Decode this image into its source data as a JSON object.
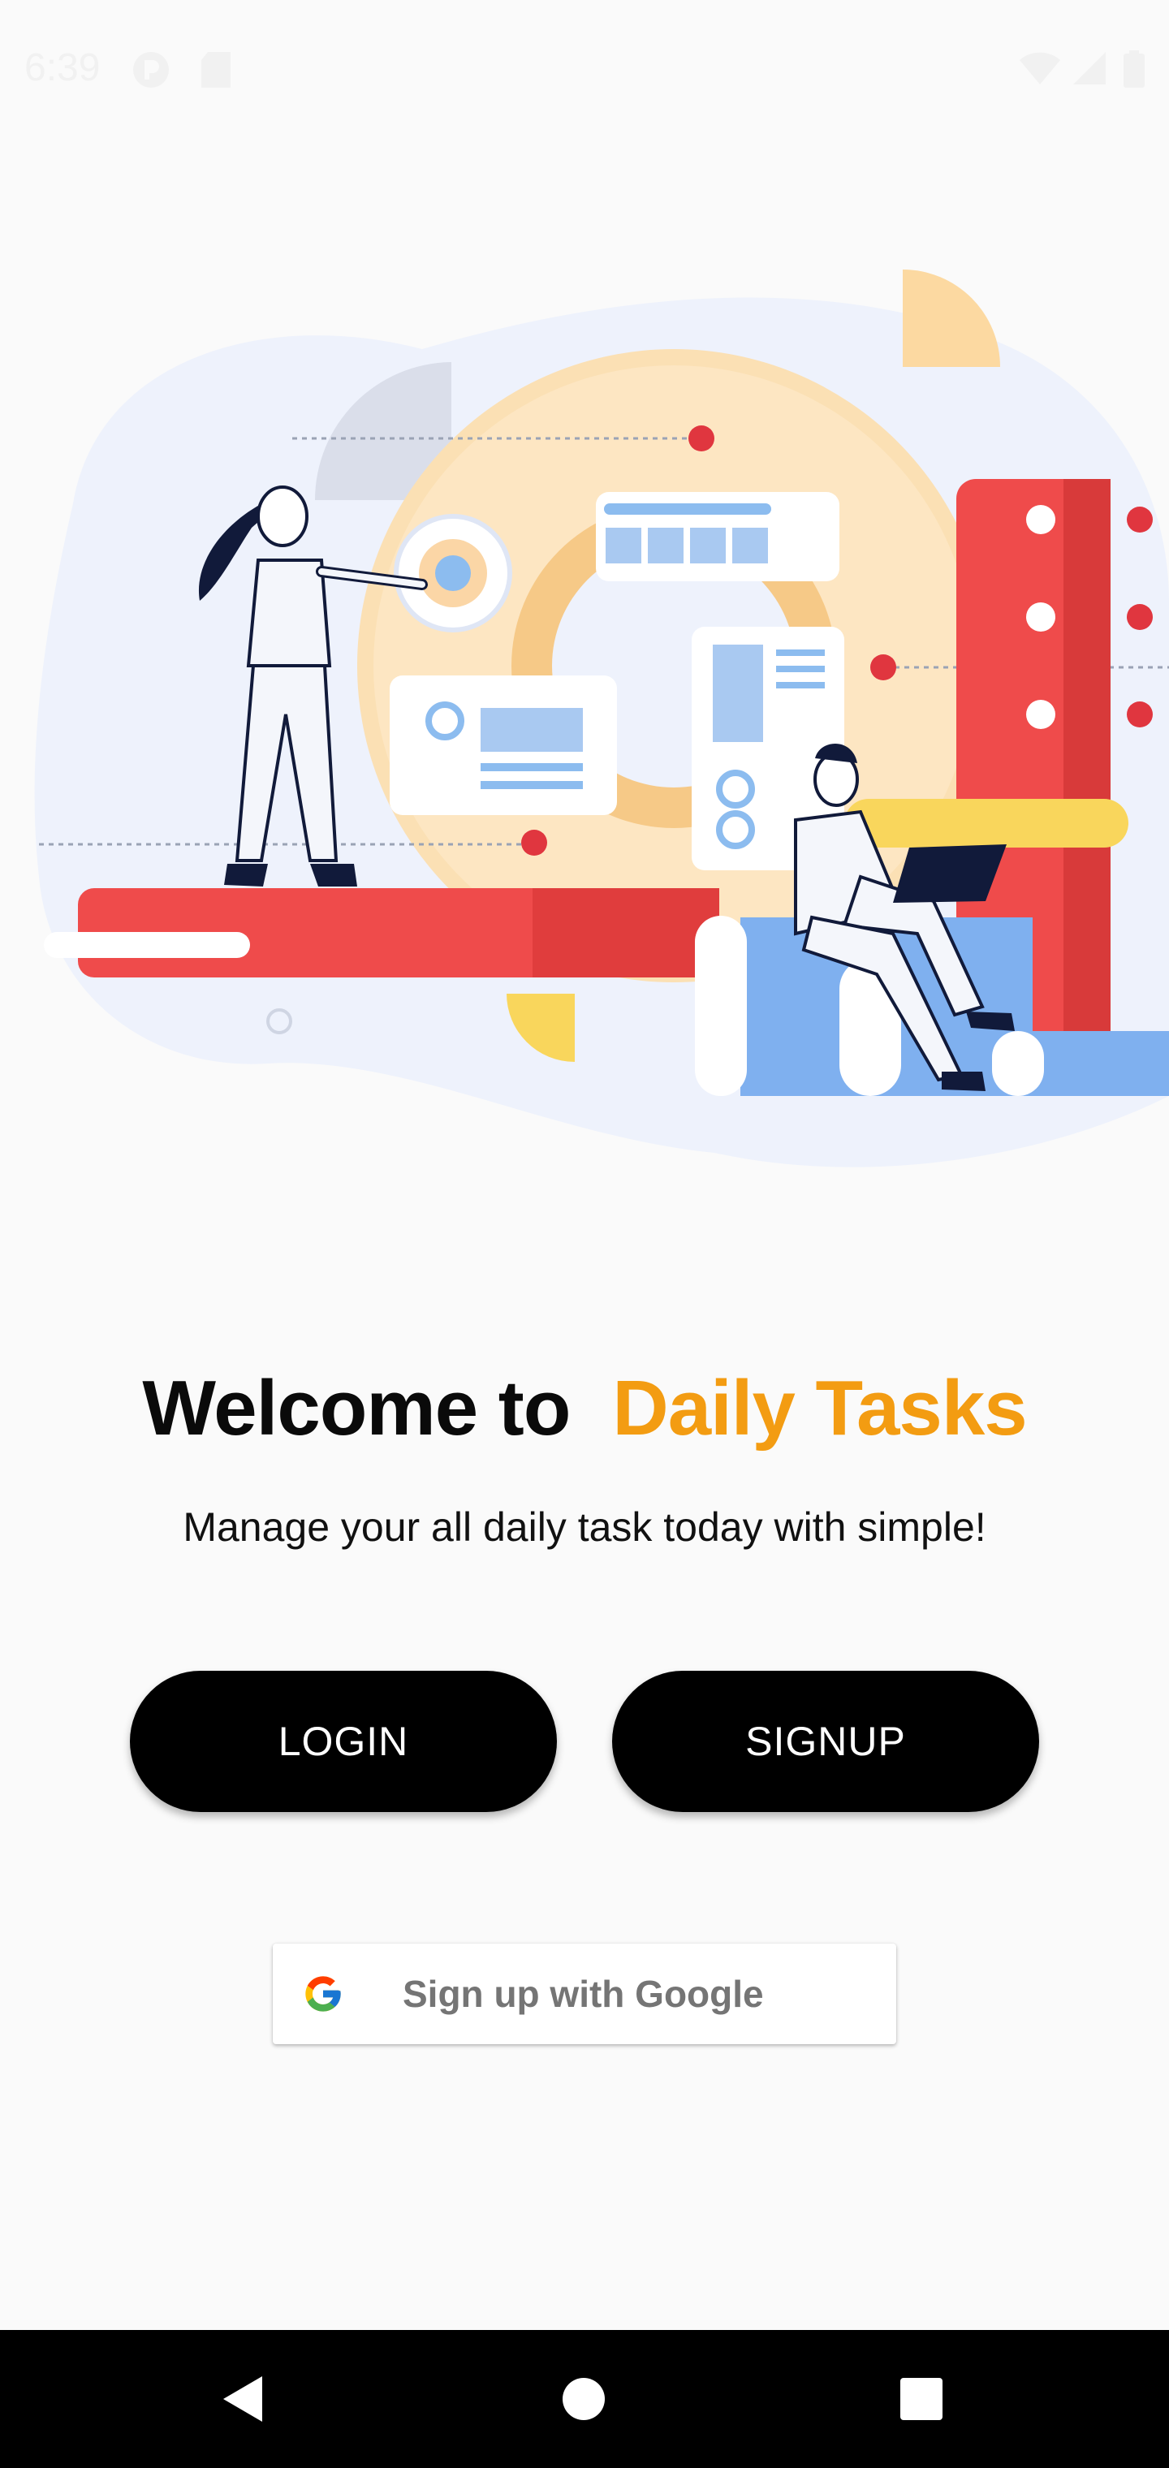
{
  "status_bar": {
    "time": "6:39"
  },
  "welcome": {
    "prefix": "Welcome to",
    "app_name": "Daily Tasks"
  },
  "subtitle": "Manage your all daily task today with simple!",
  "buttons": {
    "login": "LOGIN",
    "signup": "SIGNUP"
  },
  "google": {
    "label": "Sign up with Google"
  },
  "colors": {
    "accent": "#f39c12",
    "button_bg": "#000000",
    "hero_red": "#ef4b4b",
    "hero_blue": "#7fb0ef",
    "hero_yellow": "#f9d65c",
    "hero_peach": "#fbe0b4"
  },
  "icons": {
    "nav_back": "back-triangle-icon",
    "nav_home": "home-circle-icon",
    "nav_recents": "recents-square-icon"
  }
}
